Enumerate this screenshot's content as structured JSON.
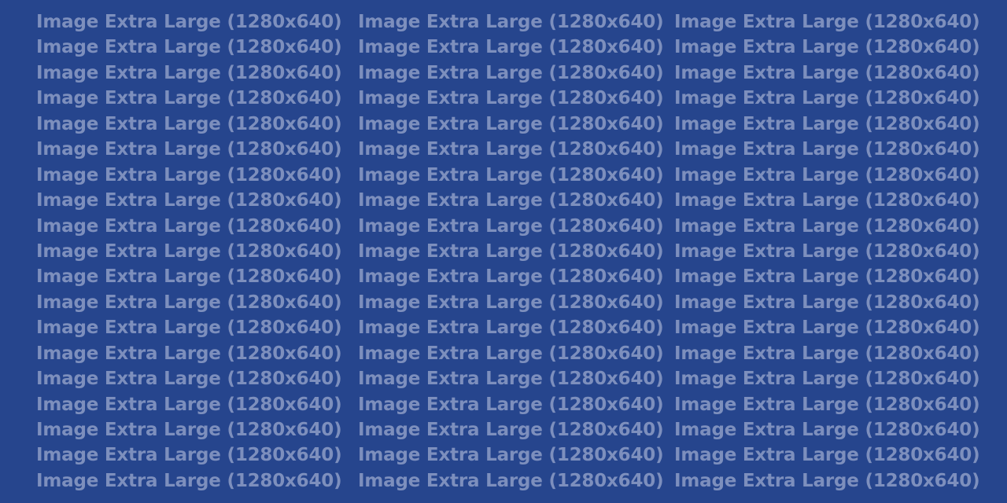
{
  "placeholder": {
    "label": "Image Extra Large (1280x640)",
    "rows": 19,
    "columns": 3,
    "colors": {
      "background": "#26458d",
      "text": "#7d8fbd"
    }
  }
}
